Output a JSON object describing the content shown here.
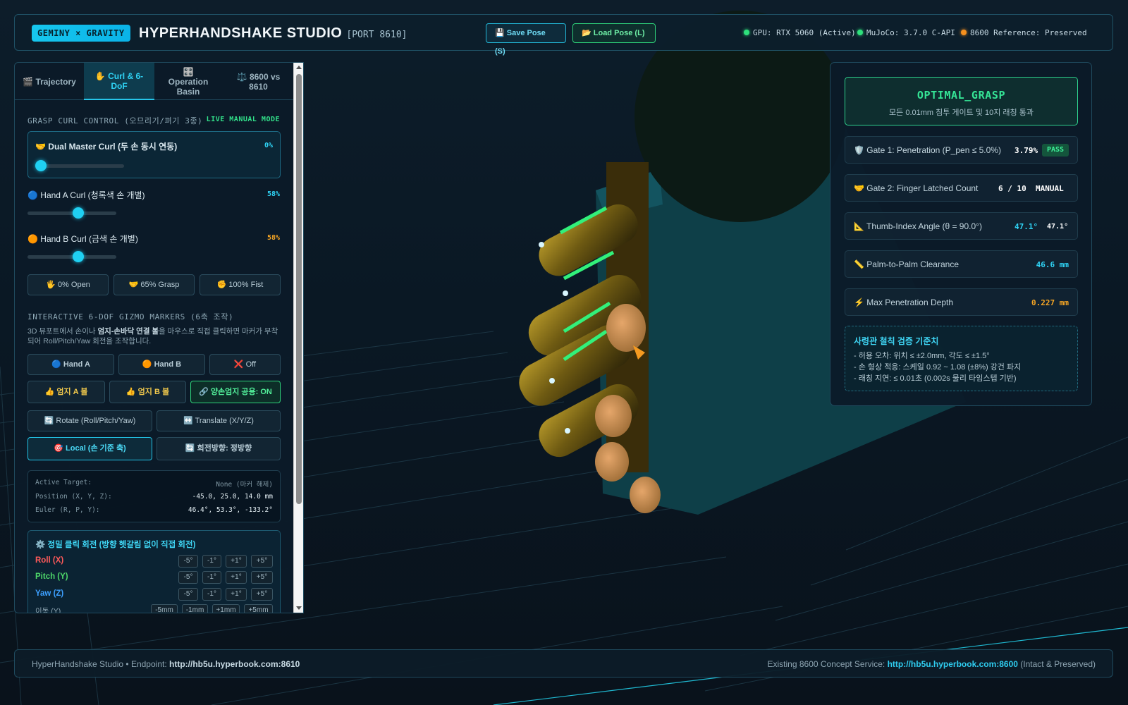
{
  "header": {
    "brand": "GEMINY × GRAVITY",
    "title": "HYPERHANDSHAKE STUDIO",
    "port": "[PORT 8610]",
    "save_button": "💾 Save Pose (S)",
    "load_button": "📂 Load Pose (L)",
    "status": [
      {
        "label": "GPU: RTX 5060 (Active)",
        "color": "#2ee07c"
      },
      {
        "label": "MuJoCo: 3.7.0 C-API",
        "color": "#2ee07c"
      },
      {
        "label": "8600 Reference: Preserved",
        "color": "#f5901e"
      }
    ]
  },
  "left_panel": {
    "tabs": [
      {
        "label": "🎬 Trajectory"
      },
      {
        "label": "✋ Curl & 6-DoF"
      },
      {
        "label": "🎛️ Operation Basin"
      },
      {
        "label": "⚖️ 8600 vs 8610"
      }
    ],
    "curl_section_title": "GRASP CURL CONTROL (오므리기/펴기 3종)",
    "live_mode": "LIVE MANUAL MODE",
    "dual_master": {
      "label": "🤝 Dual Master Curl (두 손 동시 연동)",
      "value": "0%",
      "fraction": 0.0
    },
    "hand_a": {
      "label": "🔵 Hand A Curl (청록색 손 개별)",
      "value": "58%",
      "fraction": 0.58,
      "color": "#2fd3f5"
    },
    "hand_b": {
      "label": "🟠 Hand B Curl (금색 손 개별)",
      "value": "58%",
      "fraction": 0.58,
      "color": "#f5a524"
    },
    "presets": [
      "🖐 0% Open",
      "🤝 65% Grasp",
      "✊ 100% Fist"
    ],
    "gizmo_section_title": "INTERACTIVE 6-DOF GIZMO MARKERS (6축 조작)",
    "gizmo_desc_1": "3D 뷰포트에서 손이나 ",
    "gizmo_desc_bold": "엄지-손바닥 연결 볼",
    "gizmo_desc_2": "을 마우스로 직접 클릭하면 마커가 부착되어 Roll/Pitch/Yaw 회전을 조작합니다.",
    "target_buttons": [
      "🔵 Hand A",
      "🟠 Hand B",
      "❌ Off"
    ],
    "ball_buttons": [
      "👍 엄지 A 볼",
      "👍 엄지 B 볼",
      "🔗 양손엄지 공용: ON"
    ],
    "mode_buttons": [
      "🔄 Rotate (Roll/Pitch/Yaw)",
      "↔️ Translate (X/Y/Z)"
    ],
    "frame_buttons": [
      "🎯 Local (손 기준 축)",
      "🔄 회전방향: 정방향"
    ],
    "info": [
      {
        "key": "Active Target:",
        "value": "None (마커 해제)"
      },
      {
        "key": "Position (X, Y, Z):",
        "value": "-45.0, 25.0, 14.0 mm"
      },
      {
        "key": "Euler (R, P, Y):",
        "value": "46.4°, 53.3°, -133.2°"
      }
    ],
    "precision_title": "⚙️ 정밀 클릭 회전 (방향 헷갈림 없이 직접 회전)",
    "axes": [
      {
        "label": "Roll (X)",
        "color": "#ff5a5a"
      },
      {
        "label": "Pitch (Y)",
        "color": "#4ed86a"
      },
      {
        "label": "Yaw (Z)",
        "color": "#3da0ff"
      }
    ],
    "rot_steps": [
      "-5°",
      "-1°",
      "+1°",
      "+5°"
    ],
    "move_label": "이동 (Y)",
    "move_steps": [
      "-5mm",
      "-1mm",
      "+1mm",
      "+5mm"
    ]
  },
  "right_panel": {
    "verdict_title": "OPTIMAL_GRASP",
    "verdict_sub": "모든 0.01mm 침투 게이트 및 10지 래칭 통과",
    "gate1": {
      "label": "🛡️ Gate 1: Penetration (P_pen ≤ 5.0%)",
      "value": "3.79%",
      "badge": "PASS"
    },
    "gate2": {
      "label": "🤝 Gate 2: Finger Latched Count",
      "value": "6 / 10",
      "mode": "MANUAL"
    },
    "angle": {
      "label": "📐 Thumb-Index Angle (θ = 90.0°)",
      "value_a": "47.1°",
      "value_b": "47.1°"
    },
    "clearance": {
      "label": "📏 Palm-to-Palm Clearance",
      "value": "46.6 mm"
    },
    "depth": {
      "label": "⚡ Max Penetration Depth",
      "value": "0.227 mm"
    },
    "criteria_title": "사령관 철칙 검증 기준치",
    "criteria": [
      "- 허용 오차: 위치 ≤ ±2.0mm, 각도 ≤ ±1.5°",
      "- 손 형상 적응: 스케일 0.92 ~ 1.08 (±8%) 강건 파지",
      "- 래칭 지연: ≤ 0.01초 (0.002s 물리 타임스텝 기반)"
    ]
  },
  "footer": {
    "left_prefix": "HyperHandshake Studio • Endpoint: ",
    "left_link": "http://hb5u.hyperbook.com:8610",
    "right_prefix": "Existing 8600 Concept Service: ",
    "right_link": "http://hb5u.hyperbook.com:8600",
    "right_suffix": " (Intact & Preserved)"
  }
}
